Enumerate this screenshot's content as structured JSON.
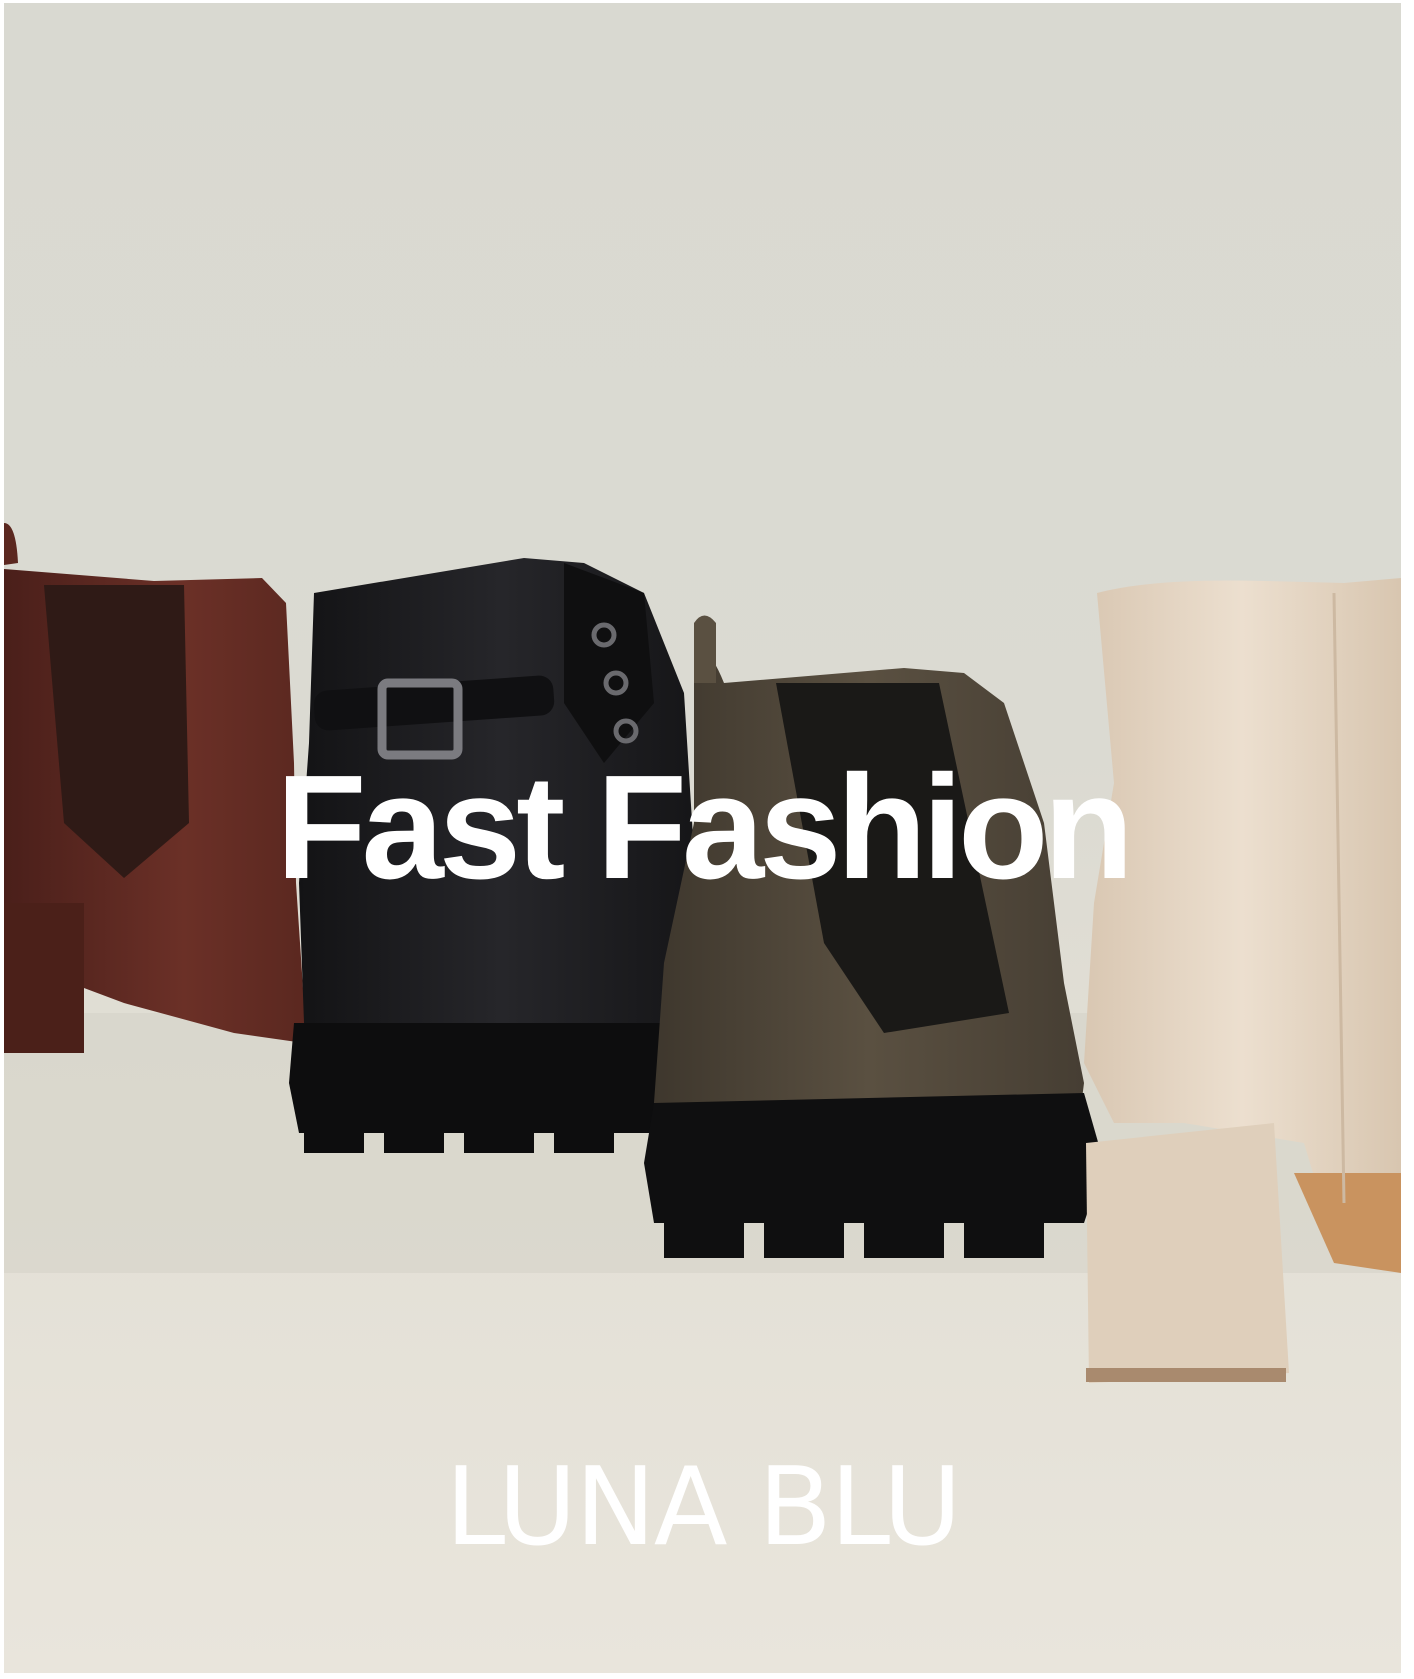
{
  "headline": "Fast Fashion",
  "brand": "LUNA BLU",
  "colors": {
    "background": "#dad9d1",
    "brown_boot": "#5a2a22",
    "black_boot": "#1c1c1e",
    "olive_boot": "#4a4236",
    "cream_boot": "#e8d9c6",
    "text": "#ffffff"
  }
}
